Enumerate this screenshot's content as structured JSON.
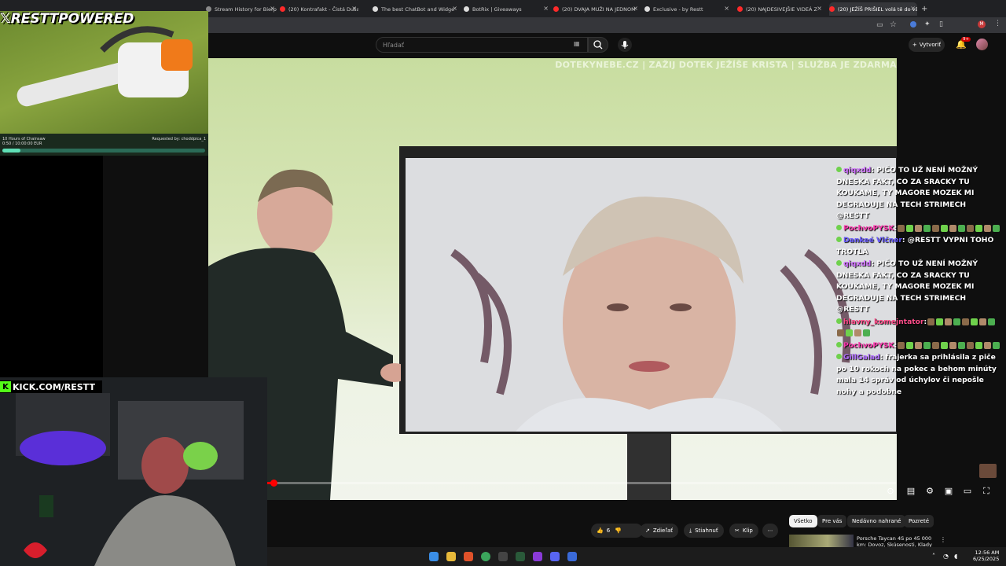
{
  "browser": {
    "tabs": [
      {
        "label": "Stream History for Bierp",
        "color": "#8a8a8a"
      },
      {
        "label": "(20) Kontrafakt - Čistá Duša p",
        "color": "#ff2a2a"
      },
      {
        "label": "The best ChatBot and Widge",
        "color": "#dddddd"
      },
      {
        "label": "BotRix | Giveaways",
        "color": "#dddddd"
      },
      {
        "label": "(20) DVAJA MUŽI NA JEDNOM",
        "color": "#ff2a2a"
      },
      {
        "label": "Exclusive - by Restt",
        "color": "#dddddd"
      },
      {
        "label": "(20) NAJDESIVEJŠIE VIDEÁ Z",
        "color": "#ff2a2a"
      },
      {
        "label": "(20) JEŽÍŠ PRIŠIEL volá tě do vš",
        "color": "#ff2a2a"
      }
    ],
    "new_tab": "+"
  },
  "youtube": {
    "search_placeholder": "Hľadať",
    "create_label": "Vytvoriť",
    "notif_count": "9+",
    "avatar_letter": "M"
  },
  "video": {
    "ticker": "DOTEKYNEBE.CZ | ZAŽIJ DOTEK JEŽÍŠE KRISTA | SLUŽBA JE ZDARMA",
    "progress": 0.01
  },
  "chat": [
    {
      "user": "qiqxdd",
      "user_color": "#d070ff",
      "text": ": PIČO TO UŽ NENÍ MOŽNÝ DNESKA FAKT, CO ZA SRACKY TU KOUKAME, TY MAGORE MOZEK MI DEGRADUJE NA TECH STRIMECH @RESTT"
    },
    {
      "user": "PochvoPYSK",
      "user_color": "#ff3ab0",
      "text": ":"
    },
    {
      "user": "Dankeé Vlčner",
      "user_color": "#6a5cff",
      "text": ": @RESTT VYPNI TOHO TROTLA"
    },
    {
      "user": "qiqxdd",
      "user_color": "#d070ff",
      "text": ": PIČO TO UŽ NENÍ MOŽNÝ DNESKA FAKT, CO ZA SRACKY TU KOUKAME, TY MAGORE MOZEK MI DEGRADUJE NA TECH STRIMECH @RESTT"
    },
    {
      "user": "hlavny_komejntator",
      "user_color": "#ff4d8a",
      "text": ":"
    },
    {
      "user": "PochvoPYSK",
      "user_color": "#ff3ab0",
      "text": ":"
    },
    {
      "user": "GillGalad",
      "user_color": "#b06cff",
      "text": ": frajerka sa prihlásila z piče po 10 rokoch na pokec a behom minúty mala 14 správ od úchylov či nepošle nohy a podobne"
    }
  ],
  "below_video": {
    "likes": "6",
    "share_label": "Zdieľať",
    "download_label": "Stiahnuť",
    "clip_label": "Klip",
    "chips": [
      "Všetko",
      "Pre vás",
      "Nedávno nahrané",
      "Pozreté"
    ],
    "reco_title": "Porsche Taycan 4S po 45 000 km: Dovoz, Skúsenosti, Klady"
  },
  "overlay": {
    "x_handle": "𝕏RESTTPOWERED",
    "chainsaw_title": "10 Hours of Chainsaw",
    "chainsaw_time": "0:50 / 10:00:00 EUR",
    "requested_by": "Requested by: choddpica_1",
    "kick_url": "KICK.COM/RESTT",
    "song_progress": 0.09
  },
  "taskbar": {
    "time": "12:56 AM",
    "date": "6/25/2025"
  }
}
